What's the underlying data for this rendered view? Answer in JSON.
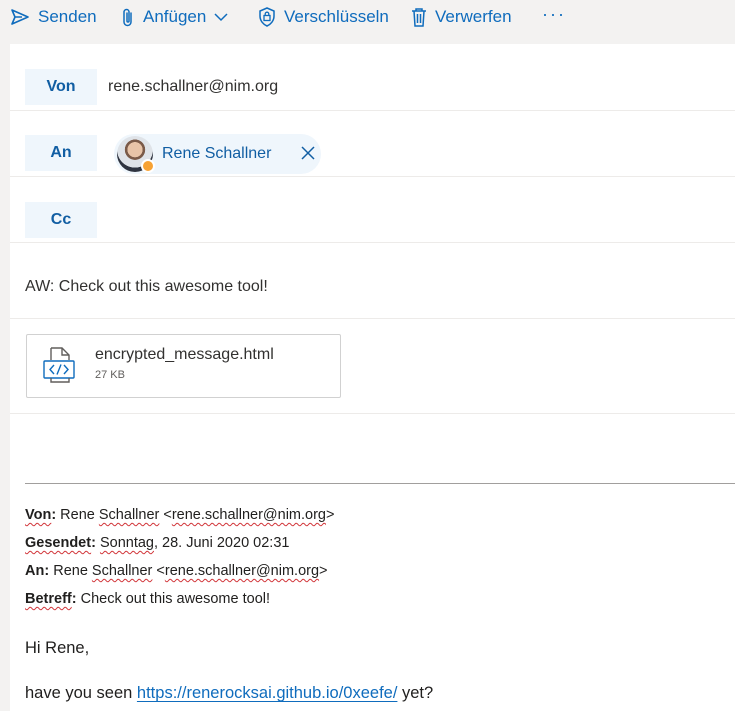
{
  "toolbar": {
    "send": "Senden",
    "attach": "Anfügen",
    "encrypt": "Verschlüsseln",
    "discard": "Verwerfen",
    "more": "···"
  },
  "header": {
    "from_label": "Von",
    "from_address": "rene.schallner@nim.org",
    "to_label": "An",
    "to_recipient": "Rene Schallner",
    "cc_label": "Cc",
    "subject": "AW: Check out this awesome tool!"
  },
  "attachment": {
    "name": "encrypted_message.html",
    "size": "27 KB"
  },
  "quoted": {
    "from_label": "Von",
    "from_value_pre": " Rene ",
    "from_value_spell": "Schallner",
    "from_value_post": " <",
    "from_email": "rene.schallner@nim.org",
    "from_close": ">",
    "sent_label": "Gesendet",
    "sent_day": "Sonntag",
    "sent_rest": ", 28. Juni 2020 02:31",
    "to_label": "An",
    "to_value_pre": " Rene ",
    "to_value_spell": "Schallner",
    "to_value_post": " <",
    "to_email": "rene.schallner@nim.org",
    "to_close": ">",
    "subject_label": "Betreff",
    "subject_value": " Check out this awesome tool!"
  },
  "body": {
    "greeting": "Hi Rene,",
    "line_pre": "have you seen ",
    "link": "https://renerocksai.github.io/0xeefe/",
    "line_post": " yet?"
  },
  "colors": {
    "accent": "#0f6cbd",
    "field_bg": "#eff6fc",
    "spellcheck": "#d13438",
    "presence": "#f7a233"
  }
}
